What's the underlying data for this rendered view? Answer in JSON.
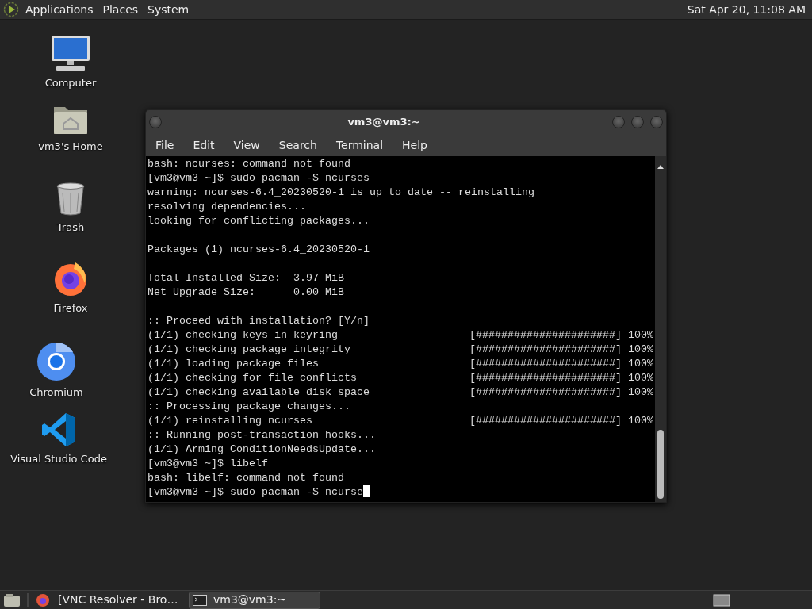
{
  "top_panel": {
    "menus": [
      "Applications",
      "Places",
      "System"
    ],
    "clock": "Sat Apr 20, 11:08 AM"
  },
  "desktop_icons": [
    {
      "kind": "computer",
      "label": "Computer"
    },
    {
      "kind": "home",
      "label": "vm3's Home"
    },
    {
      "kind": "trash",
      "label": "Trash"
    },
    {
      "kind": "firefox",
      "label": "Firefox"
    },
    {
      "kind": "chromium",
      "label": "Chromium"
    },
    {
      "kind": "vscode",
      "label": "Visual Studio Code"
    }
  ],
  "terminal": {
    "title": "vm3@vm3:~",
    "menu": [
      "File",
      "Edit",
      "View",
      "Search",
      "Terminal",
      "Help"
    ],
    "cursor_visible": true,
    "lines": [
      {
        "kind": "text",
        "text": "bash: ncurses: command not found"
      },
      {
        "kind": "text",
        "text": "[vm3@vm3 ~]$ sudo pacman -S ncurses"
      },
      {
        "kind": "text",
        "text": "warning: ncurses-6.4_20230520-1 is up to date -- reinstalling"
      },
      {
        "kind": "text",
        "text": "resolving dependencies..."
      },
      {
        "kind": "text",
        "text": "looking for conflicting packages..."
      },
      {
        "kind": "blank"
      },
      {
        "kind": "text",
        "text": "Packages (1) ncurses-6.4_20230520-1"
      },
      {
        "kind": "blank"
      },
      {
        "kind": "text",
        "text": "Total Installed Size:  3.97 MiB"
      },
      {
        "kind": "text",
        "text": "Net Upgrade Size:      0.00 MiB"
      },
      {
        "kind": "blank"
      },
      {
        "kind": "text",
        "text": ":: Proceed with installation? [Y/n]"
      },
      {
        "kind": "progress",
        "text": "(1/1) checking keys in keyring",
        "bar": "[######################]",
        "percent": "100%"
      },
      {
        "kind": "progress",
        "text": "(1/1) checking package integrity",
        "bar": "[######################]",
        "percent": "100%"
      },
      {
        "kind": "progress",
        "text": "(1/1) loading package files",
        "bar": "[######################]",
        "percent": "100%"
      },
      {
        "kind": "progress",
        "text": "(1/1) checking for file conflicts",
        "bar": "[######################]",
        "percent": "100%"
      },
      {
        "kind": "progress",
        "text": "(1/1) checking available disk space",
        "bar": "[######################]",
        "percent": "100%"
      },
      {
        "kind": "text",
        "text": ":: Processing package changes..."
      },
      {
        "kind": "progress",
        "text": "(1/1) reinstalling ncurses",
        "bar": "[######################]",
        "percent": "100%"
      },
      {
        "kind": "text",
        "text": ":: Running post-transaction hooks..."
      },
      {
        "kind": "text",
        "text": "(1/1) Arming ConditionNeedsUpdate..."
      },
      {
        "kind": "text",
        "text": "[vm3@vm3 ~]$ libelf"
      },
      {
        "kind": "text",
        "text": "bash: libelf: command not found"
      },
      {
        "kind": "text",
        "text": "[vm3@vm3 ~]$ sudo pacman -S ncurse"
      }
    ]
  },
  "taskbar": {
    "tasks": [
      {
        "kind": "browser",
        "label": "[VNC Resolver - Bro…",
        "selected": false
      },
      {
        "kind": "terminal",
        "label": "vm3@vm3:~",
        "selected": true
      }
    ]
  }
}
